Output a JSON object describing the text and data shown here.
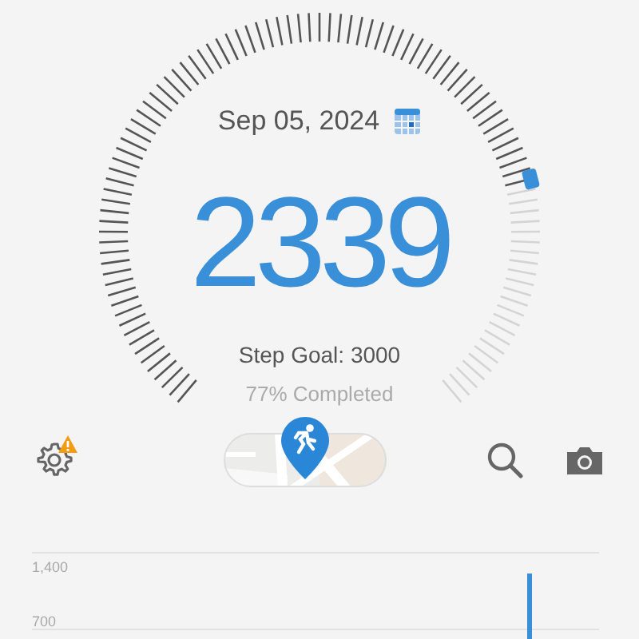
{
  "date": "Sep 05, 2024",
  "steps": "2339",
  "goal": "Step Goal: 3000",
  "completion": "77% Completed",
  "toolbar": {
    "settings_warning": true
  },
  "chart": {
    "axis_labels": [
      "1,400",
      "700"
    ]
  }
}
